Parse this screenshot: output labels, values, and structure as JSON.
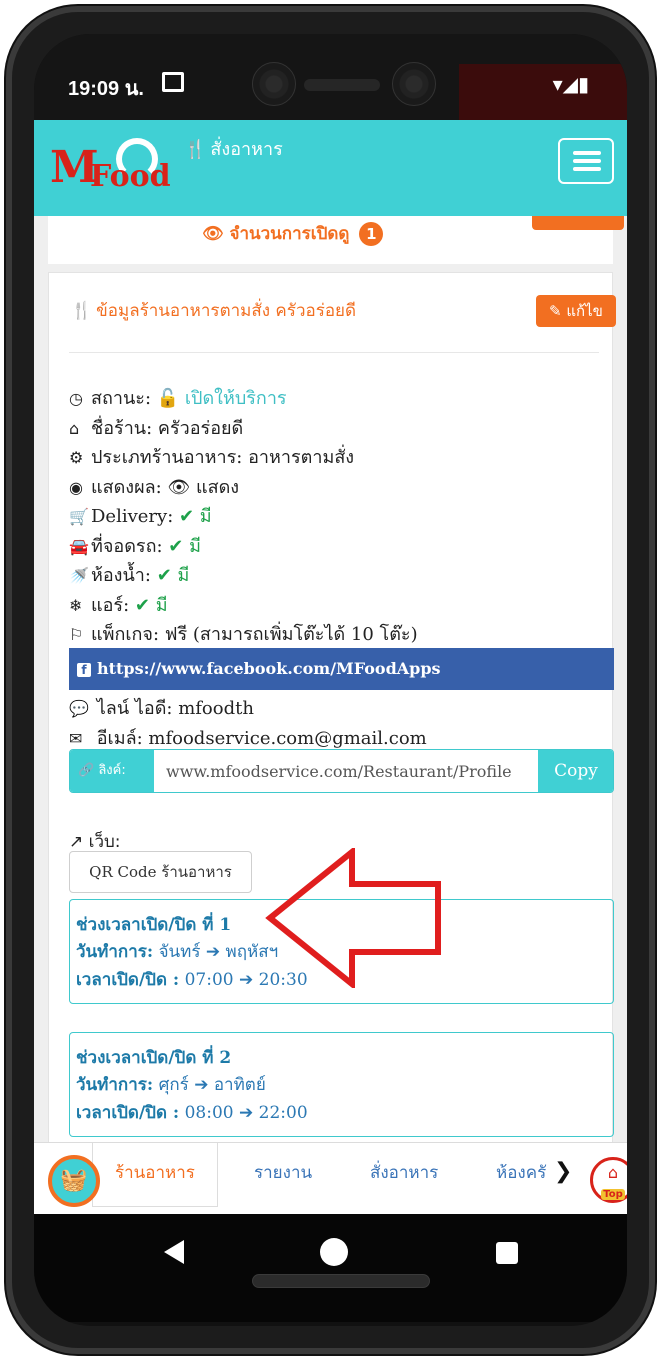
{
  "status_bar": {
    "time": "19:09 น.",
    "icons": "▾◢▮"
  },
  "navbar": {
    "logo_m": "M",
    "logo_food": "Food",
    "brand_icon": "🍴",
    "brand_text": "สั่งอาหาร"
  },
  "top_card": {
    "views_label": "👁 จำนวนการเปิดดู",
    "views_count": "1"
  },
  "card": {
    "header_icon": "🍴",
    "header": "ข้อมูลร้านอาหารตามสั่ง ครัวอร่อยดี",
    "edit_label": "✎ แก้ไข",
    "info": [
      {
        "icon": "◷",
        "label": "สถานะ:",
        "value": "🔓 เปิดให้บริการ",
        "style": "teal"
      },
      {
        "icon": "⌂",
        "label": "ชื่อร้าน:",
        "value": "ครัวอร่อยดี",
        "style": ""
      },
      {
        "icon": "⚙",
        "label": "ประเภทร้านอาหาร:",
        "value": "อาหารตามสั่ง",
        "style": ""
      },
      {
        "icon": "◉",
        "label": "แสดงผล:",
        "value": "👁 แสดง",
        "style": ""
      },
      {
        "icon": "🛒",
        "label": "Delivery:",
        "value": "✔ มี",
        "style": "green"
      },
      {
        "icon": "🚘",
        "label": "ที่จอดรถ:",
        "value": "✔ มี",
        "style": "green"
      },
      {
        "icon": "🚿",
        "label": "ห้องน้ำ:",
        "value": "✔ มี",
        "style": "green"
      },
      {
        "icon": "❄",
        "label": "แอร์:",
        "value": "✔ มี",
        "style": "green"
      },
      {
        "icon": "⚐",
        "label": "แพ็กเกจ:",
        "value": "ฟรี (สามารถเพิ่มโต๊ะได้ 10 โต๊ะ)",
        "style": ""
      }
    ],
    "facebook": "https://www.facebook.com/MFoodApps",
    "line": {
      "icon": "💬",
      "label": "ไลน์ ไอดี:",
      "value": "mfoodth"
    },
    "email": {
      "icon": "✉",
      "label": "อีเมล์:",
      "value": "mfoodservice.com@gmail.com"
    },
    "link": {
      "addon": "🔗 ลิงค์:",
      "value": "www.mfoodservice.com/Restaurant/Profile",
      "copy": "Copy"
    },
    "web_label": "↗ เว็บ:",
    "qr_button": "QR Code ร้านอาหาร",
    "time_slots": [
      {
        "title": "ช่วงเวลาเปิด/ปิด ที่ 1",
        "days_label": "วันทำการ:",
        "days": "จันทร์ ➔ พฤหัสฯ",
        "time_label": "เวลาเปิด/ปิด :",
        "time": "07:00 ➔ 20:30"
      },
      {
        "title": "ช่วงเวลาเปิด/ปิด ที่ 2",
        "days_label": "วันทำการ:",
        "days": "ศุกร์ ➔ อาทิตย์",
        "time_label": "เวลาเปิด/ปิด :",
        "time": "08:00 ➔ 22:00"
      }
    ]
  },
  "bottom_tabs": {
    "items": [
      "ร้านอาหาร",
      "รายงาน",
      "สั่งอาหาร",
      "ห้องครั"
    ],
    "more": "❯",
    "top_label": "Top"
  },
  "colors": {
    "teal": "#40d0d4",
    "orange": "#f26f21",
    "red": "#d8231a",
    "facebook": "#3760aa",
    "green": "#1ea14a"
  }
}
